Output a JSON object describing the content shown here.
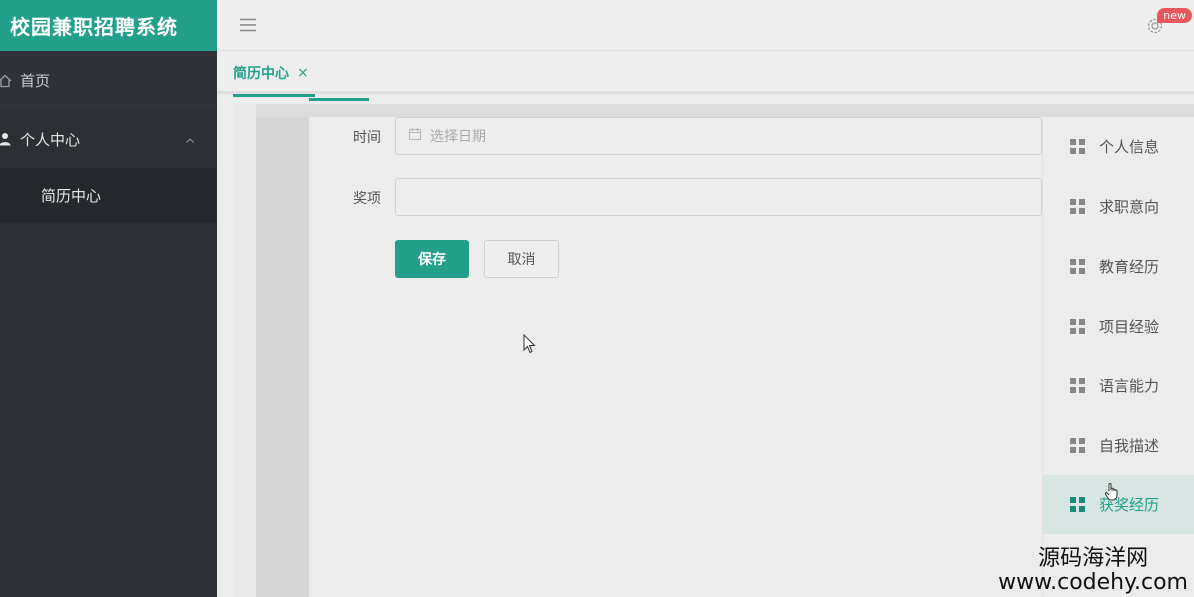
{
  "app": {
    "title": "校园兼职招聘系统"
  },
  "sidebar": {
    "home_label": "首页",
    "group_label": "个人中心",
    "sub_item_label": "简历中心"
  },
  "topbar": {
    "badge": "new"
  },
  "tabs": [
    {
      "label": "简历中心",
      "close": "×"
    }
  ],
  "form": {
    "time_label": "时间",
    "time_placeholder": "选择日期",
    "award_label": "奖项",
    "award_value": "",
    "save_label": "保存",
    "cancel_label": "取消"
  },
  "right_menu": {
    "items": [
      "个人信息",
      "求职意向",
      "教育经历",
      "项目经验",
      "语言能力",
      "自我描述",
      "获奖经历"
    ],
    "active_index": 6
  },
  "watermark": {
    "cn": "源码海洋网",
    "en": "www.codehy.com"
  },
  "colors": {
    "accent": "#22a08a",
    "sidebar": "#2c3034",
    "badge": "#e9575c"
  }
}
